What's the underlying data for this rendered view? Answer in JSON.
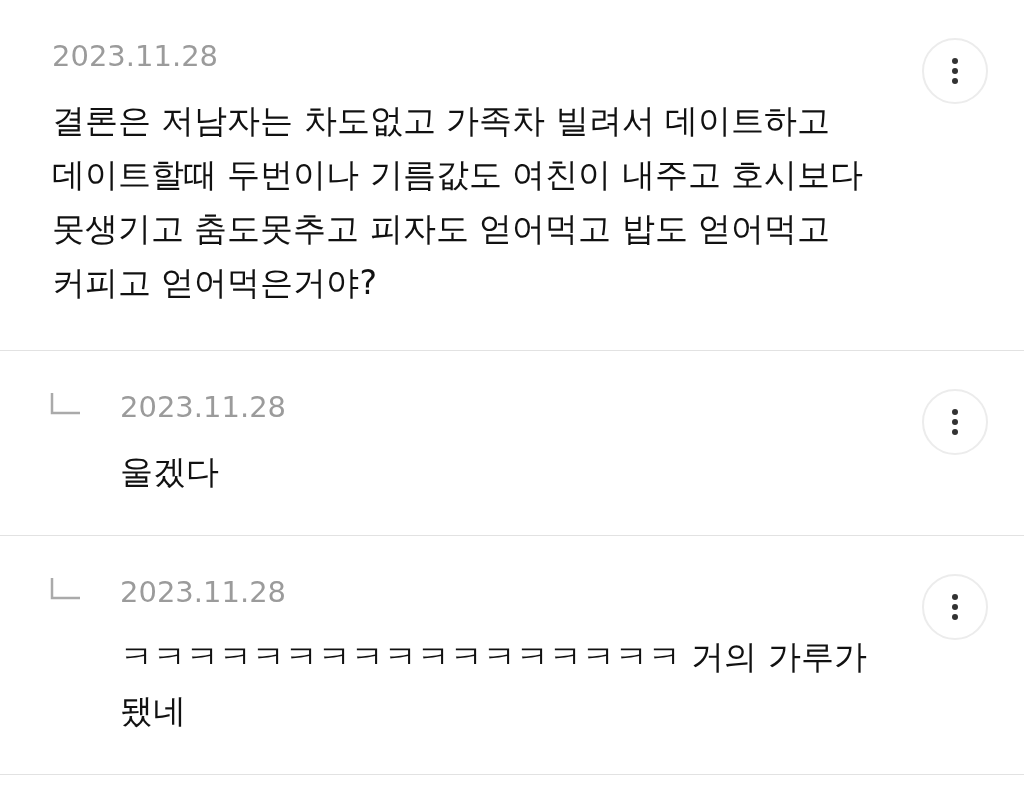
{
  "comments": [
    {
      "kind": "comment",
      "date": "2023.11.28",
      "text": "결론은 저남자는 차도없고 가족차 빌려서 데이트하고 데이트할때 두번이나 기름값도 여친이 내주고 호시보다 못생기고 춤도못추고 피자도 얻어먹고 밥도 얻어먹고 커피고 얻어먹은거야?"
    },
    {
      "kind": "reply",
      "date": "2023.11.28",
      "text": "울겠다"
    },
    {
      "kind": "reply",
      "date": "2023.11.28",
      "text": "ㅋㅋㅋㅋㅋㅋㅋㅋㅋㅋㅋㅋㅋㅋㅋㅋㅋ 거의 가루가 됐네"
    }
  ]
}
